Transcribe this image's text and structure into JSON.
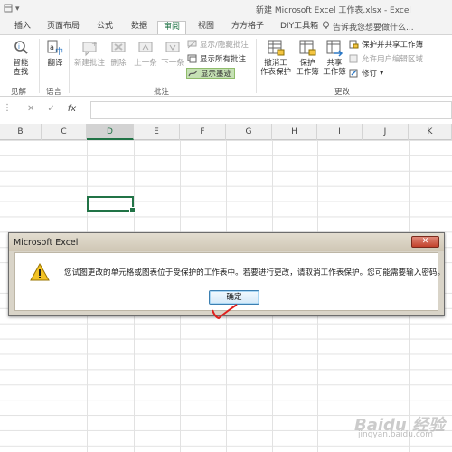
{
  "window": {
    "title": "新建 Microsoft Excel 工作表.xlsx - Excel",
    "qat_dropdown": "▾"
  },
  "tabs": [
    {
      "label": "插入"
    },
    {
      "label": "页面布局"
    },
    {
      "label": "公式"
    },
    {
      "label": "数据"
    },
    {
      "label": "审阅",
      "active": true
    },
    {
      "label": "视图"
    },
    {
      "label": "方方格子"
    },
    {
      "label": "DIY工具箱"
    }
  ],
  "tell_me": "告诉我您想要做什么...",
  "ribbon": {
    "proofing": {
      "smart_lookup": "智能\n查找",
      "group": "见解"
    },
    "language": {
      "translate": "翻译",
      "group": "语言"
    },
    "comments": {
      "new": "新建批注",
      "delete": "删除",
      "prev": "上一条",
      "next": "下一条",
      "show_hide": "显示/隐藏批注",
      "show_all": "显示所有批注",
      "show_ink": "显示墨迹",
      "group": "批注"
    },
    "changes": {
      "unprotect_sheet": "撤消工\n作表保护",
      "protect_workbook": "保护\n工作簿",
      "share_workbook": "共享\n工作簿",
      "protect_share": "保护并共享工作簿",
      "allow_edit_ranges": "允许用户编辑区域",
      "track_changes": "修订",
      "group": "更改"
    }
  },
  "formula_bar": {
    "name_box_icon": "⋮",
    "cancel": "✕",
    "enter": "✓",
    "fx": "fx",
    "value": ""
  },
  "columns": [
    "B",
    "C",
    "D",
    "E",
    "F",
    "G",
    "H",
    "I",
    "J",
    "K"
  ],
  "selected_column": "D",
  "dialog": {
    "title": "Microsoft Excel",
    "close": "✕",
    "message": "您试图更改的单元格或图表位于受保护的工作表中。若要进行更改，请取消工作表保护。您可能需要输入密码。",
    "ok": "确定"
  },
  "watermark": {
    "brand": "Baidu 经验",
    "url": "jingyan.baidu.com"
  }
}
